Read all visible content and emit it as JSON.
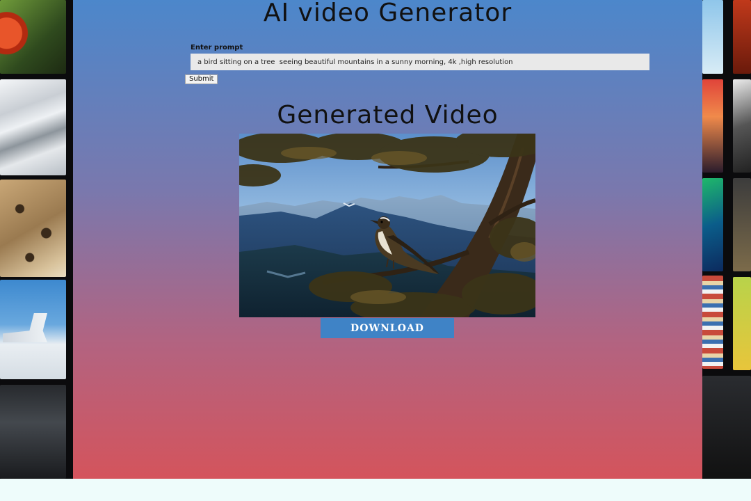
{
  "header": {
    "title": "AI video Generator"
  },
  "form": {
    "label": "Enter prompt",
    "prompt_value": "a bird sitting on a tree  seeing beautiful mountains in a sunny morning, 4k ,high resolution",
    "submit_label": "Submit"
  },
  "result": {
    "heading": "Generated Video",
    "download_label": "DOWNLOAD"
  },
  "colors": {
    "panel_top": "#4c87cb",
    "panel_bottom": "#d4545c",
    "download_button": "#3f83c6",
    "page_background": "#eefcfb"
  }
}
